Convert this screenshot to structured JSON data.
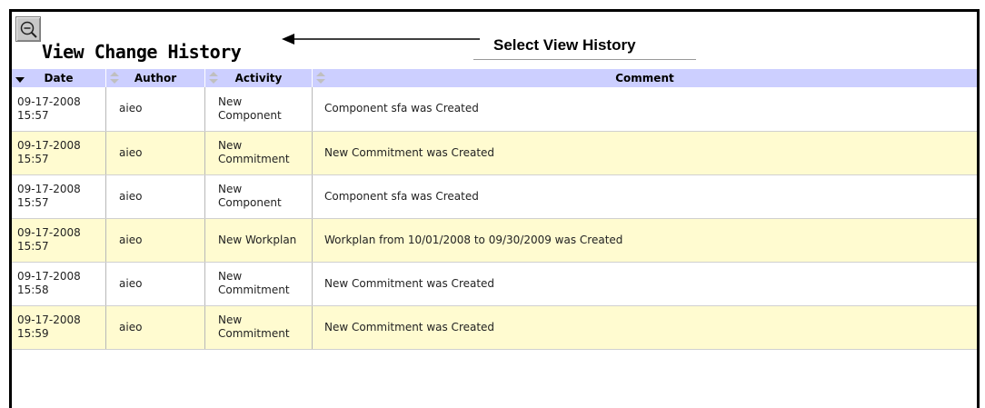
{
  "header": {
    "title": "View Change History",
    "annotation": "Select View History"
  },
  "table": {
    "columns": [
      "Date",
      "Author",
      "Activity",
      "Comment"
    ],
    "rows": [
      {
        "date": "09-17-2008 15:57",
        "author": "aieo",
        "activity": "New Component",
        "comment": "Component sfa was Created"
      },
      {
        "date": "09-17-2008 15:57",
        "author": "aieo",
        "activity": "New Commitment",
        "comment": "New Commitment was Created"
      },
      {
        "date": "09-17-2008 15:57",
        "author": "aieo",
        "activity": "New Component",
        "comment": "Component sfa was Created"
      },
      {
        "date": "09-17-2008 15:57",
        "author": "aieo",
        "activity": "New Workplan",
        "comment": "Workplan from 10/01/2008 to 09/30/2009 was Created"
      },
      {
        "date": "09-17-2008 15:58",
        "author": "aieo",
        "activity": "New Commitment",
        "comment": "New Commitment was Created"
      },
      {
        "date": "09-17-2008 15:59",
        "author": "aieo",
        "activity": "New Commitment",
        "comment": "New Commitment was Created"
      }
    ]
  },
  "colors": {
    "header_bg": "#cccfff",
    "row_alt_bg": "#fffbd0",
    "row_bg": "#ffffff"
  }
}
